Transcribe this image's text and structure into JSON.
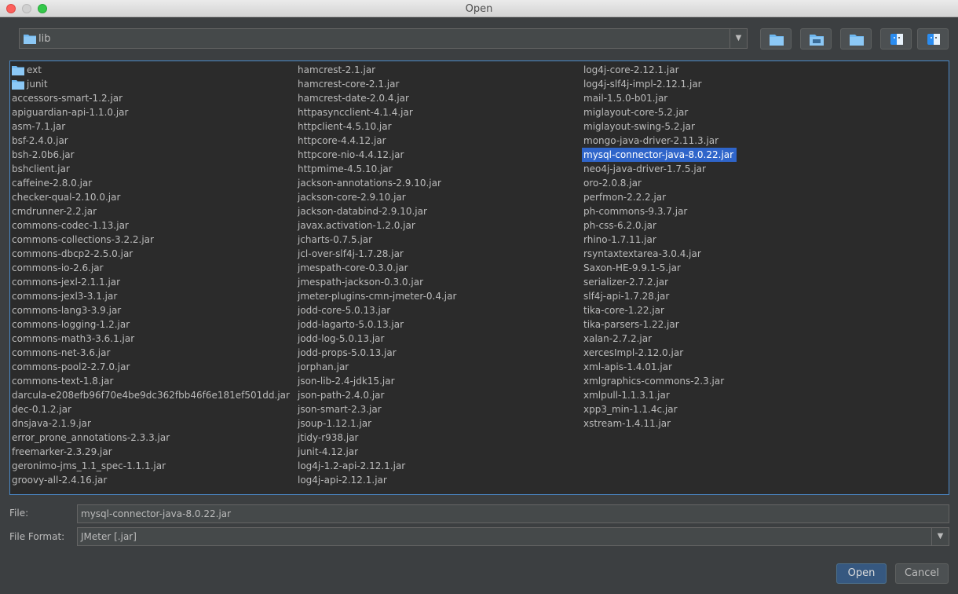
{
  "window": {
    "title": "Open"
  },
  "path": {
    "current": "lib"
  },
  "toolbar": {
    "buttons": [
      {
        "name": "home-folder-button",
        "icon": "folder-icon"
      },
      {
        "name": "desktop-button",
        "icon": "desktop-folder-icon"
      },
      {
        "name": "new-folder-button",
        "icon": "new-folder-icon"
      },
      {
        "name": "list-view-button",
        "icon": "finder-icon"
      },
      {
        "name": "details-view-button",
        "icon": "finder-icon"
      }
    ]
  },
  "files": {
    "columns": [
      [
        {
          "name": "ext",
          "type": "dir"
        },
        {
          "name": "junit",
          "type": "dir"
        },
        {
          "name": "accessors-smart-1.2.jar"
        },
        {
          "name": "apiguardian-api-1.1.0.jar"
        },
        {
          "name": "asm-7.1.jar"
        },
        {
          "name": "bsf-2.4.0.jar"
        },
        {
          "name": "bsh-2.0b6.jar"
        },
        {
          "name": "bshclient.jar"
        },
        {
          "name": "caffeine-2.8.0.jar"
        },
        {
          "name": "checker-qual-2.10.0.jar"
        },
        {
          "name": "cmdrunner-2.2.jar"
        },
        {
          "name": "commons-codec-1.13.jar"
        },
        {
          "name": "commons-collections-3.2.2.jar"
        },
        {
          "name": "commons-dbcp2-2.5.0.jar"
        },
        {
          "name": "commons-io-2.6.jar"
        },
        {
          "name": "commons-jexl-2.1.1.jar"
        },
        {
          "name": "commons-jexl3-3.1.jar"
        },
        {
          "name": "commons-lang3-3.9.jar"
        },
        {
          "name": "commons-logging-1.2.jar"
        },
        {
          "name": "commons-math3-3.6.1.jar"
        },
        {
          "name": "commons-net-3.6.jar"
        },
        {
          "name": "commons-pool2-2.7.0.jar"
        },
        {
          "name": "commons-text-1.8.jar"
        },
        {
          "name": "darcula-e208efb96f70e4be9dc362fbb46f6e181ef501dd.jar"
        },
        {
          "name": "dec-0.1.2.jar"
        },
        {
          "name": "dnsjava-2.1.9.jar"
        },
        {
          "name": "error_prone_annotations-2.3.3.jar"
        },
        {
          "name": "freemarker-2.3.29.jar"
        },
        {
          "name": "geronimo-jms_1.1_spec-1.1.1.jar"
        },
        {
          "name": "groovy-all-2.4.16.jar"
        }
      ],
      [
        {
          "name": "hamcrest-2.1.jar"
        },
        {
          "name": "hamcrest-core-2.1.jar"
        },
        {
          "name": "hamcrest-date-2.0.4.jar"
        },
        {
          "name": "httpasyncclient-4.1.4.jar"
        },
        {
          "name": "httpclient-4.5.10.jar"
        },
        {
          "name": "httpcore-4.4.12.jar"
        },
        {
          "name": "httpcore-nio-4.4.12.jar"
        },
        {
          "name": "httpmime-4.5.10.jar"
        },
        {
          "name": "jackson-annotations-2.9.10.jar"
        },
        {
          "name": "jackson-core-2.9.10.jar"
        },
        {
          "name": "jackson-databind-2.9.10.jar"
        },
        {
          "name": "javax.activation-1.2.0.jar"
        },
        {
          "name": "jcharts-0.7.5.jar"
        },
        {
          "name": "jcl-over-slf4j-1.7.28.jar"
        },
        {
          "name": "jmespath-core-0.3.0.jar"
        },
        {
          "name": "jmespath-jackson-0.3.0.jar"
        },
        {
          "name": "jmeter-plugins-cmn-jmeter-0.4.jar"
        },
        {
          "name": "jodd-core-5.0.13.jar"
        },
        {
          "name": "jodd-lagarto-5.0.13.jar"
        },
        {
          "name": "jodd-log-5.0.13.jar"
        },
        {
          "name": "jodd-props-5.0.13.jar"
        },
        {
          "name": "jorphan.jar"
        },
        {
          "name": "json-lib-2.4-jdk15.jar"
        },
        {
          "name": "json-path-2.4.0.jar"
        },
        {
          "name": "json-smart-2.3.jar"
        },
        {
          "name": "jsoup-1.12.1.jar"
        },
        {
          "name": "jtidy-r938.jar"
        },
        {
          "name": "junit-4.12.jar"
        },
        {
          "name": "log4j-1.2-api-2.12.1.jar"
        },
        {
          "name": "log4j-api-2.12.1.jar"
        }
      ],
      [
        {
          "name": "log4j-core-2.12.1.jar"
        },
        {
          "name": "log4j-slf4j-impl-2.12.1.jar"
        },
        {
          "name": "mail-1.5.0-b01.jar"
        },
        {
          "name": "miglayout-core-5.2.jar"
        },
        {
          "name": "miglayout-swing-5.2.jar"
        },
        {
          "name": "mongo-java-driver-2.11.3.jar"
        },
        {
          "name": "mysql-connector-java-8.0.22.jar",
          "selected": true
        },
        {
          "name": "neo4j-java-driver-1.7.5.jar"
        },
        {
          "name": "oro-2.0.8.jar"
        },
        {
          "name": "perfmon-2.2.2.jar"
        },
        {
          "name": "ph-commons-9.3.7.jar"
        },
        {
          "name": "ph-css-6.2.0.jar"
        },
        {
          "name": "rhino-1.7.11.jar"
        },
        {
          "name": "rsyntaxtextarea-3.0.4.jar"
        },
        {
          "name": "Saxon-HE-9.9.1-5.jar"
        },
        {
          "name": "serializer-2.7.2.jar"
        },
        {
          "name": "slf4j-api-1.7.28.jar"
        },
        {
          "name": "tika-core-1.22.jar"
        },
        {
          "name": "tika-parsers-1.22.jar"
        },
        {
          "name": "xalan-2.7.2.jar"
        },
        {
          "name": "xercesImpl-2.12.0.jar"
        },
        {
          "name": "xml-apis-1.4.01.jar"
        },
        {
          "name": "xmlgraphics-commons-2.3.jar"
        },
        {
          "name": "xmlpull-1.1.3.1.jar"
        },
        {
          "name": "xpp3_min-1.1.4c.jar"
        },
        {
          "name": "xstream-1.4.11.jar"
        }
      ]
    ]
  },
  "file_field": {
    "label": "File:",
    "value": "mysql-connector-java-8.0.22.jar"
  },
  "format_field": {
    "label": "File Format:",
    "value": "JMeter [.jar]"
  },
  "buttons": {
    "open": "Open",
    "cancel": "Cancel"
  },
  "colors": {
    "background": "#3c3f41",
    "list_bg": "#2b2b2b",
    "selection": "#2f65ca",
    "folder": "#6fb8f0",
    "accent_border": "#4a88c7"
  }
}
